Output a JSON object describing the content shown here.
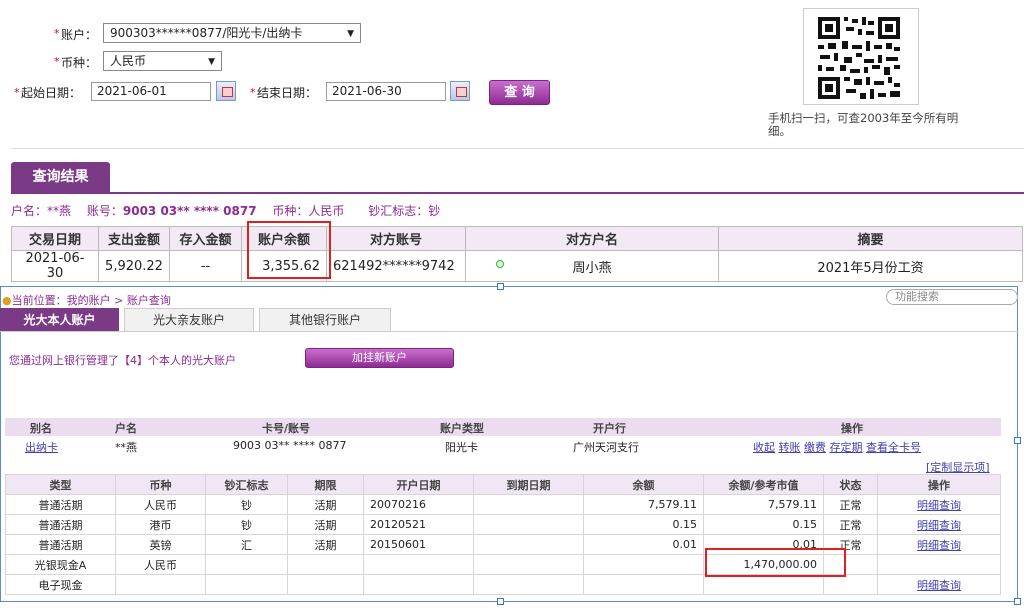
{
  "query": {
    "account_label": "账户：",
    "account_value": "900303******0877/阳光卡/出纳卡",
    "currency_label": "币种：",
    "currency_value": "人民币",
    "start_label": "起始日期：",
    "start_value": "2021-06-01",
    "end_label": "结束日期：",
    "end_value": "2021-06-30",
    "query_button": "查 询",
    "star": "*"
  },
  "qr": {
    "caption": "手机扫一扫，可查2003年至今所有明细。"
  },
  "result": {
    "tab_title": "查询结果",
    "info": {
      "name_label": "户名：",
      "name": "**燕",
      "acct_label": "账号：",
      "acct": "9003 03** **** 0877",
      "cur_label": "币种：",
      "cur": "人民币",
      "flag_label": "钞汇标志：",
      "flag": "钞"
    },
    "headers": [
      "交易日期",
      "支出金额",
      "存入金额",
      "账户余额",
      "对方账号",
      "对方户名",
      "摘要"
    ],
    "rows": [
      [
        "2021-06-30",
        "5,920.22",
        "--",
        "3,355.62",
        "621492******9742",
        "周小燕",
        "2021年5月份工资"
      ]
    ]
  },
  "lower": {
    "breadcrumb": {
      "prefix": "当前位置：",
      "home": "我的账户",
      "sep": " > ",
      "current": "账户查询"
    },
    "search_placeholder": "功能搜索",
    "tabs": [
      "光大本人账户",
      "光大亲友账户",
      "其他银行账户"
    ],
    "manage_text": "您通过网上银行管理了【4】个本人的光大账户",
    "add_button": "加挂新账户",
    "acct_headers": [
      "别名",
      "户名",
      "卡号/账号",
      "账户类型",
      "开户行",
      "操作"
    ],
    "acct_row": {
      "alias": "出纳卡",
      "name": "**燕",
      "card": "9003 03** **** 0877",
      "type": "阳光卡",
      "bank": "广州天河支行"
    },
    "ops": [
      "收起",
      "转账",
      "缴费",
      "存定期",
      "查看全卡号"
    ],
    "custom_link": "[定制显示项]",
    "detail_headers": [
      "类型",
      "币种",
      "钞汇标志",
      "期限",
      "开户日期",
      "到期日期",
      "余额",
      "余额/参考市值",
      "状态",
      "操作"
    ],
    "detail_rows": [
      [
        "普通活期",
        "人民币",
        "钞",
        "活期",
        "20070216",
        "",
        "7,579.11",
        "7,579.11",
        "正常",
        "明细查询"
      ],
      [
        "普通活期",
        "港币",
        "钞",
        "活期",
        "20120521",
        "",
        "0.15",
        "0.15",
        "正常",
        "明细查询"
      ],
      [
        "普通活期",
        "英镑",
        "汇",
        "活期",
        "20150601",
        "",
        "0.01",
        "0.01",
        "正常",
        "明细查询"
      ],
      [
        "光银现金A",
        "人民币",
        "",
        "",
        "",
        "",
        "",
        "1,470,000.00",
        "",
        ""
      ],
      [
        "电子现金",
        "",
        "",
        "",
        "",
        "",
        "",
        "",
        "",
        "明细查询"
      ]
    ]
  },
  "colors": {
    "accent": "#8e2a93",
    "tab_bg": "#7b3a86",
    "link": "#4040b0",
    "highlight": "#e02020"
  }
}
